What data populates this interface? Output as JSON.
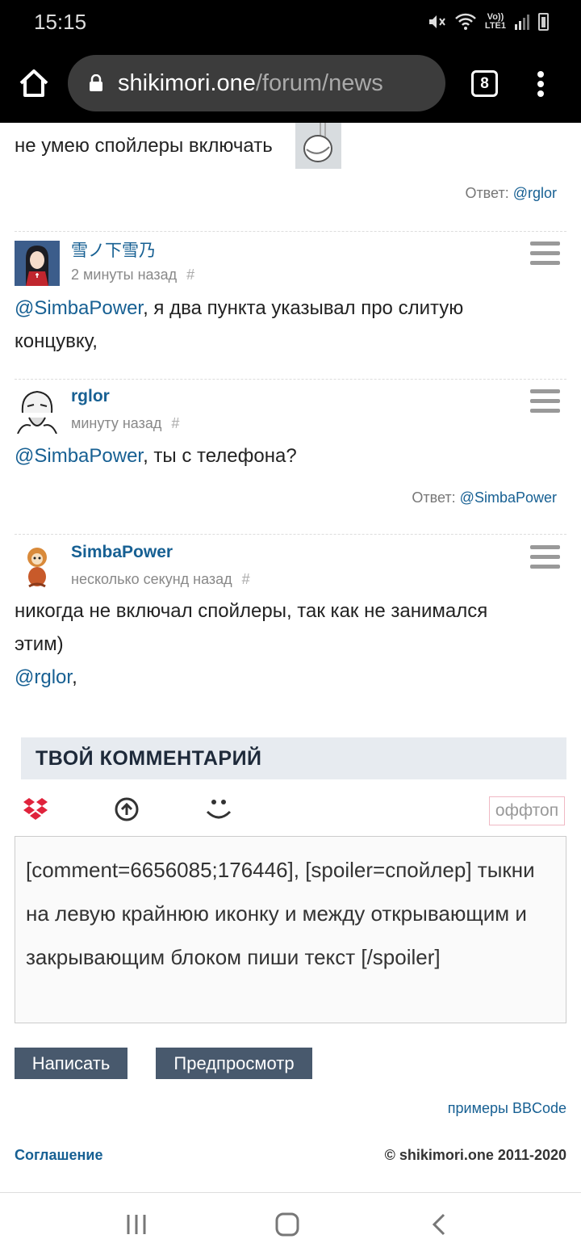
{
  "status": {
    "time": "15:15",
    "network": "Vo))\nLTE1"
  },
  "browser": {
    "url_host": "shikimori.one",
    "url_path": "/forum/news",
    "tab_count": "8"
  },
  "first_post": {
    "text": "не умею спойлеры включать",
    "reply_label": "Ответ:",
    "reply_user": "@rglor"
  },
  "posts": [
    {
      "author": "雪ノ下雪乃",
      "time": "2 минуты назад",
      "hash": "#",
      "mention": "@SimbaPower",
      "text": ", я два пункта указывал про слитую концувку,"
    },
    {
      "author": "rglor",
      "time": "минуту назад",
      "hash": "#",
      "mention": "@SimbaPower",
      "text": ", ты с телефона?",
      "reply_label": "Ответ:",
      "reply_user": "@SimbaPower"
    },
    {
      "author": "SimbaPower",
      "time": "несколько секунд назад",
      "hash": "#",
      "text": "никогда не включал спойлеры, так как не занимался этим)",
      "mention": "@rglor",
      "text_after": ","
    }
  ],
  "comment_form": {
    "title": "ТВОЙ КОММЕНТАРИЙ",
    "offtop": "оффтоп",
    "editor_value": "[comment=6656085;176446], [spoiler=спойлер] тыкни на левую крайнюю иконку и между открывающим и закрывающим блоком пиши текст [/spoiler]",
    "submit_label": "Написать",
    "preview_label": "Предпросмотр",
    "bbcode_link": "примеры BBCode"
  },
  "footer": {
    "agreement": "Соглашение",
    "copyright": "© shikimori.one 2011-2020"
  },
  "colors": {
    "link": "#176093",
    "button": "#48596d",
    "section_bg": "#e7ebf0"
  }
}
